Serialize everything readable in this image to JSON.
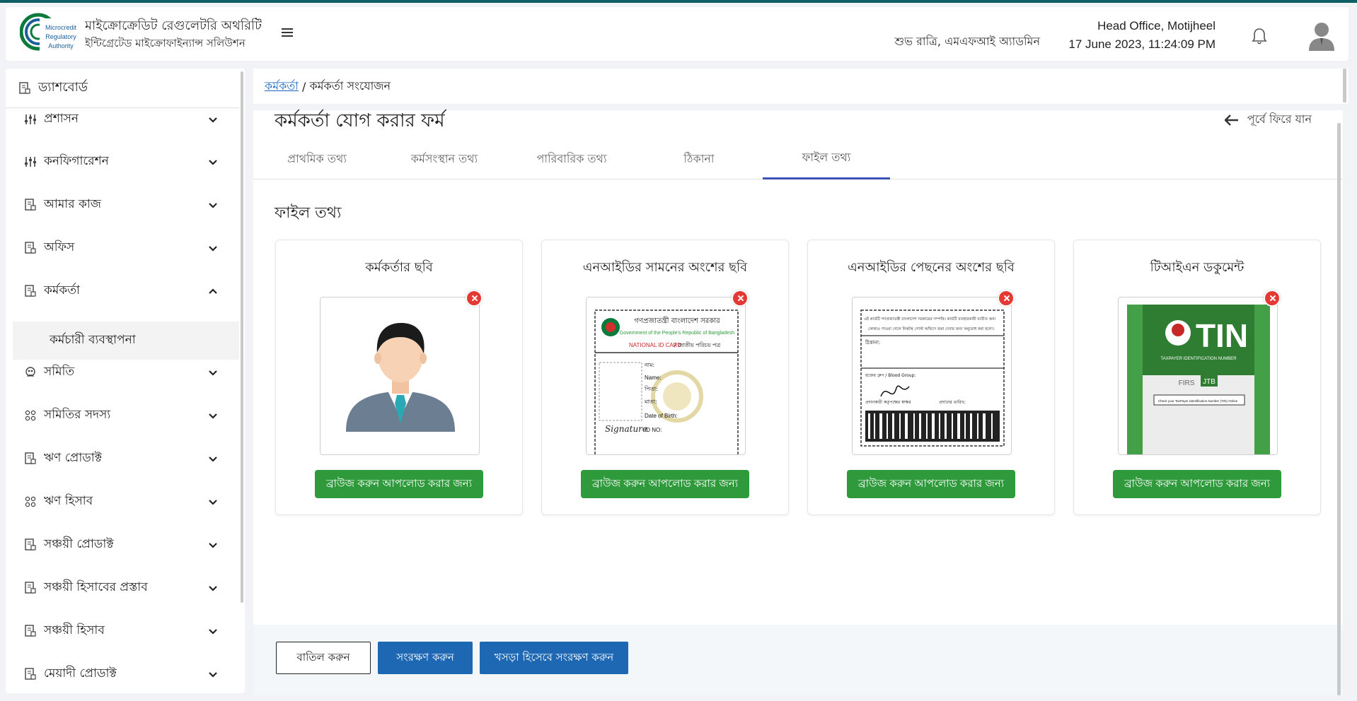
{
  "header": {
    "logo_lines": [
      "Microcredit",
      "Regulatory",
      "Authority"
    ],
    "brand_line1": "মাইক্রোক্রেডিট রেগুলেটরি অথরিটি",
    "brand_line2": "ইন্টিগ্রেটেড মাইক্রোফাইন্যান্স সলিউশন",
    "greeting": "শুভ রাত্রি, এমএফআই অ্যাডমিন",
    "office": "Head Office, Motijheel",
    "datetime": "17 June 2023, 11:24:09 PM",
    "icons": [
      "menu-icon",
      "bell-icon",
      "user-avatar-icon"
    ]
  },
  "sidebar": {
    "dashboard": "ড্যাশবোর্ড",
    "items": [
      {
        "label": "প্রশাসন",
        "icon": "sliders-icon",
        "expanded": false
      },
      {
        "label": "কনফিগারেশন",
        "icon": "sliders-icon",
        "expanded": false
      },
      {
        "label": "আমার কাজ",
        "icon": "document-icon",
        "expanded": false
      },
      {
        "label": "অফিস",
        "icon": "document-icon",
        "expanded": false
      },
      {
        "label": "কর্মকর্তা",
        "icon": "document-icon",
        "expanded": true
      },
      {
        "label": "সমিতি",
        "icon": "group-icon",
        "expanded": false
      },
      {
        "label": "সমিতির সদস্য",
        "icon": "members-icon",
        "expanded": false
      },
      {
        "label": "ঋণ প্রোডাক্ট",
        "icon": "document-icon",
        "expanded": false
      },
      {
        "label": "ঋণ হিসাব",
        "icon": "members-icon",
        "expanded": false
      },
      {
        "label": "সঞ্চয়ী প্রোডাক্ট",
        "icon": "document-icon",
        "expanded": false
      },
      {
        "label": "সঞ্চয়ী হিসাবের প্রস্তাব",
        "icon": "document-icon",
        "expanded": false
      },
      {
        "label": "সঞ্চয়ী হিসাব",
        "icon": "document-icon",
        "expanded": false
      },
      {
        "label": "মেয়াদী প্রোডাক্ট",
        "icon": "document-icon",
        "expanded": false
      }
    ],
    "sub_item": "কর্মচারী ব্যবস্থাপনা"
  },
  "breadcrumb": {
    "link": "কর্মকর্তা",
    "separator": " / ",
    "current": "কর্মকর্তা সংযোজন"
  },
  "page": {
    "title": "কর্মকর্তা যোগ করার ফর্ম",
    "back": "পূর্বে ফিরে যান",
    "tabs": [
      {
        "label": "প্রাথমিক তথ্য",
        "active": false
      },
      {
        "label": "কর্মসংস্থান তথ্য",
        "active": false
      },
      {
        "label": "পারিবারিক তথ্য",
        "active": false
      },
      {
        "label": "ঠিকানা",
        "active": false
      },
      {
        "label": "ফাইল তথ্য",
        "active": true
      }
    ],
    "section_title": "ফাইল তথ্য",
    "cards": [
      {
        "title": "কর্মকর্তার ছবি",
        "upload": "ব্রাউজ করুন আপলোড করার জন্য"
      },
      {
        "title": "এনআইডির সামনের অংশের ছবি",
        "upload": "ব্রাউজ করুন আপলোড করার জন্য"
      },
      {
        "title": "এনআইডির পেছনের অংশের ছবি",
        "upload": "ব্রাউজ করুন আপলোড করার জন্য"
      },
      {
        "title": "টিআইএন ডকুমেন্ট",
        "upload": "ব্রাউজ করুন আপলোড করার জন্য"
      }
    ],
    "nid_front": {
      "header_bn": "গণপ্রজাতন্ত্রী বাংলাদেশ সরকার",
      "header_en": "Government of the People's Republic of Bangladesh",
      "card_en": "NATIONAL ID CARD",
      "card_bn": " / জাতীয় পরিচয় পত্র",
      "fields": [
        "নাম:",
        "Name:",
        "পিতা:",
        "মাতা:",
        "Date of Birth:",
        "ID NO:"
      ],
      "signature": "Signature"
    },
    "nid_back": {
      "text1": "এই কার্ডটি গণপ্রজাতন্ত্রী বাংলাদেশ সরকারের সম্পত্তি। কার্ডটি ব্যবহারকারী ব্যতীত অন্য",
      "text2": "কোথাও পাওয়া গেলে নিকটস্থ পোস্ট অফিসে জমা দেবার জন্য অনুরোধ করা হলো।",
      "address": "ঠিকানা:",
      "blood": "রক্তের গ্রুপ / Blood Group:",
      "signer": "প্রদানকারী কর্তৃপক্ষের স্বাক্ষর",
      "issue_date": "প্রদানের তারিখ:"
    },
    "tin": {
      "big": "TIN",
      "sub": "TAXPAYER IDENTIFICATION NUMBER",
      "firs": "FIRS",
      "jtb": "JTB",
      "check": "Check your TaxPayer Identification Number (TIN) Online"
    },
    "actions": {
      "cancel": "বাতিল করুন",
      "save": "সংরক্ষণ করুন",
      "draft": "খসড়া হিসেবে সংরক্ষণ করুন"
    }
  }
}
